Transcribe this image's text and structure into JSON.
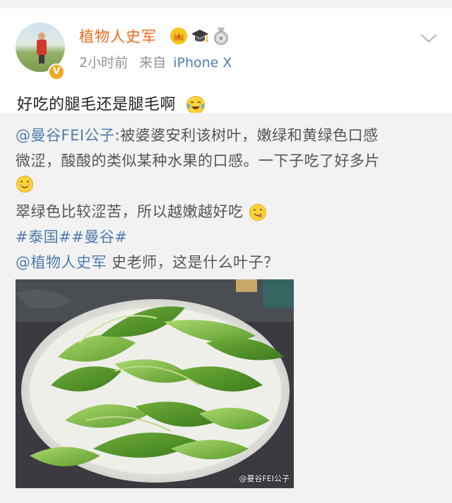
{
  "post": {
    "username": "植物人史军",
    "time": "2小时前",
    "from_label": "来自",
    "device": "iPhone X",
    "text": "好吃的腿毛还是腿毛啊"
  },
  "repost": {
    "mention": "@曼谷FEI公子",
    "line1_rest": ":被婆婆安利该树叶，嫩绿和黄绿色口感",
    "line2": "微涩，酸酸的类似某种水果的口感。一下子吃了好多片",
    "line4": "翠绿色比较涩苦，所以越嫩越好吃",
    "topics": "#泰国##曼谷#",
    "mention2": "@植物人史军",
    "question": " 史老师，这是什么叶子？",
    "watermark": "@曼谷FEI公子"
  },
  "colors": {
    "username": "#f26a1b",
    "link": "#507daf",
    "meta": "#939393",
    "repost_bg": "#f2f2f2"
  },
  "icons": {
    "avatar_badge": "v-verified-icon",
    "badges": [
      "crown-icon",
      "graduation-cap-icon",
      "medal-icon"
    ],
    "menu": "chevron-down-icon",
    "post_emoji": "crying-laughing-emoji",
    "smile_emoji": "smile-emoji",
    "yum_emoji": "yum-emoji"
  }
}
